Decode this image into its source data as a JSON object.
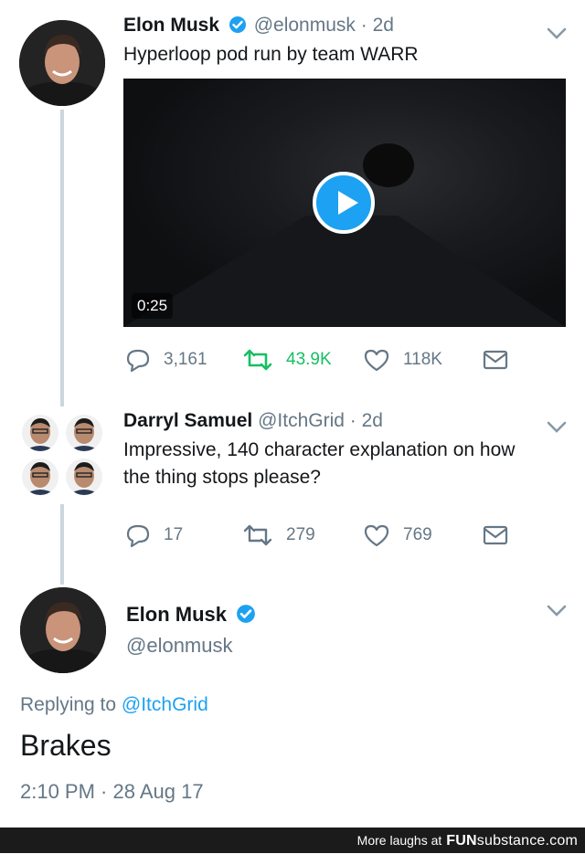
{
  "tweet1": {
    "name": "Elon Musk",
    "handle": "@elonmusk",
    "time": "· 2d",
    "text": "Hyperloop pod run by team WARR",
    "video_duration": "0:25",
    "replies": "3,161",
    "retweets": "43.9K",
    "likes": "118K"
  },
  "tweet2": {
    "name": "Darryl Samuel",
    "handle": "@ItchGrid",
    "time": "· 2d",
    "text_line1": "Impressive, 140 character explanation on how",
    "text_line2": "the thing stops please?",
    "replies": "17",
    "retweets": "279",
    "likes": "769"
  },
  "tweet3": {
    "name": "Elon Musk",
    "handle": "@elonmusk",
    "replying_prefix": "Replying to",
    "replying_to": "@ItchGrid",
    "text": "Brakes",
    "timestamp": "2:10 PM · 28 Aug 17"
  },
  "footer": {
    "label": "More laughs at",
    "brand_main": "FUN",
    "brand_sub": "substance",
    "brand_tld": ".com"
  },
  "colors": {
    "link_blue": "#1da1f2",
    "retweet_green": "#17bf63",
    "gray_text": "#657786",
    "thread_line": "#ccd6dd"
  },
  "icons": [
    "verified-badge-icon",
    "chevron-down-icon",
    "play-icon",
    "reply-icon",
    "retweet-icon",
    "like-icon",
    "direct-message-icon"
  ]
}
